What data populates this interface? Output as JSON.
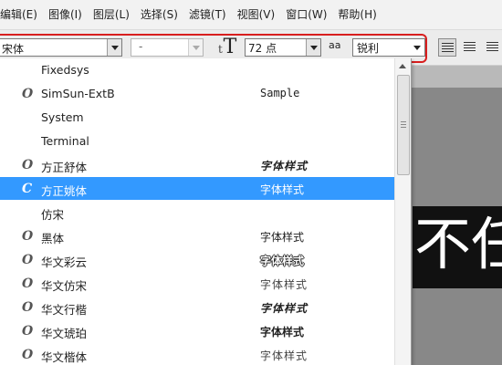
{
  "menu": [
    "编辑(E)",
    "图像(I)",
    "图层(L)",
    "选择(S)",
    "滤镜(T)",
    "视图(V)",
    "窗口(W)",
    "帮助(H)"
  ],
  "toolbar": {
    "font_family": "宋体",
    "font_style": "-",
    "font_size": "72 点",
    "antialias_label": "aa",
    "antialias": "锐利",
    "highlight_color": "#d81e1e"
  },
  "font_list": [
    {
      "icon": "",
      "name": "Fixedsys",
      "sample": "",
      "sample_style": ""
    },
    {
      "icon": "O",
      "name": "SimSun-ExtB",
      "sample": "Sample",
      "sample_style": "mono"
    },
    {
      "icon": "",
      "name": "System",
      "sample": "",
      "sample_style": ""
    },
    {
      "icon": "",
      "name": "Terminal",
      "sample": "",
      "sample_style": ""
    },
    {
      "icon": "O",
      "name": "方正舒体",
      "sample": "字体样式",
      "sample_style": "script"
    },
    {
      "icon": "C",
      "name": "方正姚体",
      "sample": "字体样式",
      "sample_style": "",
      "selected": true
    },
    {
      "icon": "",
      "name": "仿宋",
      "sample": "",
      "sample_style": ""
    },
    {
      "icon": "O",
      "name": "黑体",
      "sample": "字体样式",
      "sample_style": ""
    },
    {
      "icon": "O",
      "name": "华文彩云",
      "sample": "字体样式",
      "sample_style": "outline"
    },
    {
      "icon": "O",
      "name": "华文仿宋",
      "sample": "字体样式",
      "sample_style": "light"
    },
    {
      "icon": "O",
      "name": "华文行楷",
      "sample": "字体样式",
      "sample_style": "script"
    },
    {
      "icon": "O",
      "name": "华文琥珀",
      "sample": "字体样式",
      "sample_style": "bold"
    },
    {
      "icon": "O",
      "name": "华文楷体",
      "sample": "字体样式",
      "sample_style": "light"
    }
  ],
  "canvas": {
    "text": "不任"
  },
  "selection_color": "#3399ff"
}
